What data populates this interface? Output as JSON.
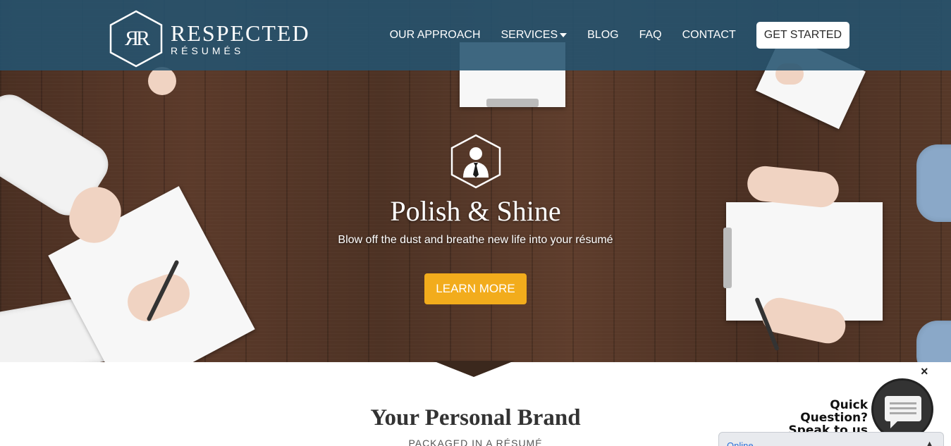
{
  "header": {
    "logo": {
      "mark": "ЯR",
      "name": "RESPECTED",
      "sub": "RÉSUMÉS"
    },
    "nav": [
      {
        "label": "OUR APPROACH"
      },
      {
        "label": "SERVICES"
      },
      {
        "label": "BLOG"
      },
      {
        "label": "FAQ"
      },
      {
        "label": "CONTACT"
      }
    ],
    "cta_label": "GET STARTED"
  },
  "hero": {
    "icon": "businessman-hex-icon",
    "title": "Polish & Shine",
    "subtitle": "Blow off the dust and breathe new life into your résumé",
    "button_label": "LEARN MORE"
  },
  "section": {
    "title": "Your Personal Brand",
    "subtitle": "PACKAGED IN A RÉSUMÉ"
  },
  "chat": {
    "close_icon": "×",
    "line1": "Quick Question?",
    "line2": "Speak to us here!",
    "status": "Online",
    "chevron": "▲"
  },
  "colors": {
    "header_bg": "#245370",
    "accent_button": "#f2ac1c",
    "chat_status": "#2a6fd6"
  }
}
